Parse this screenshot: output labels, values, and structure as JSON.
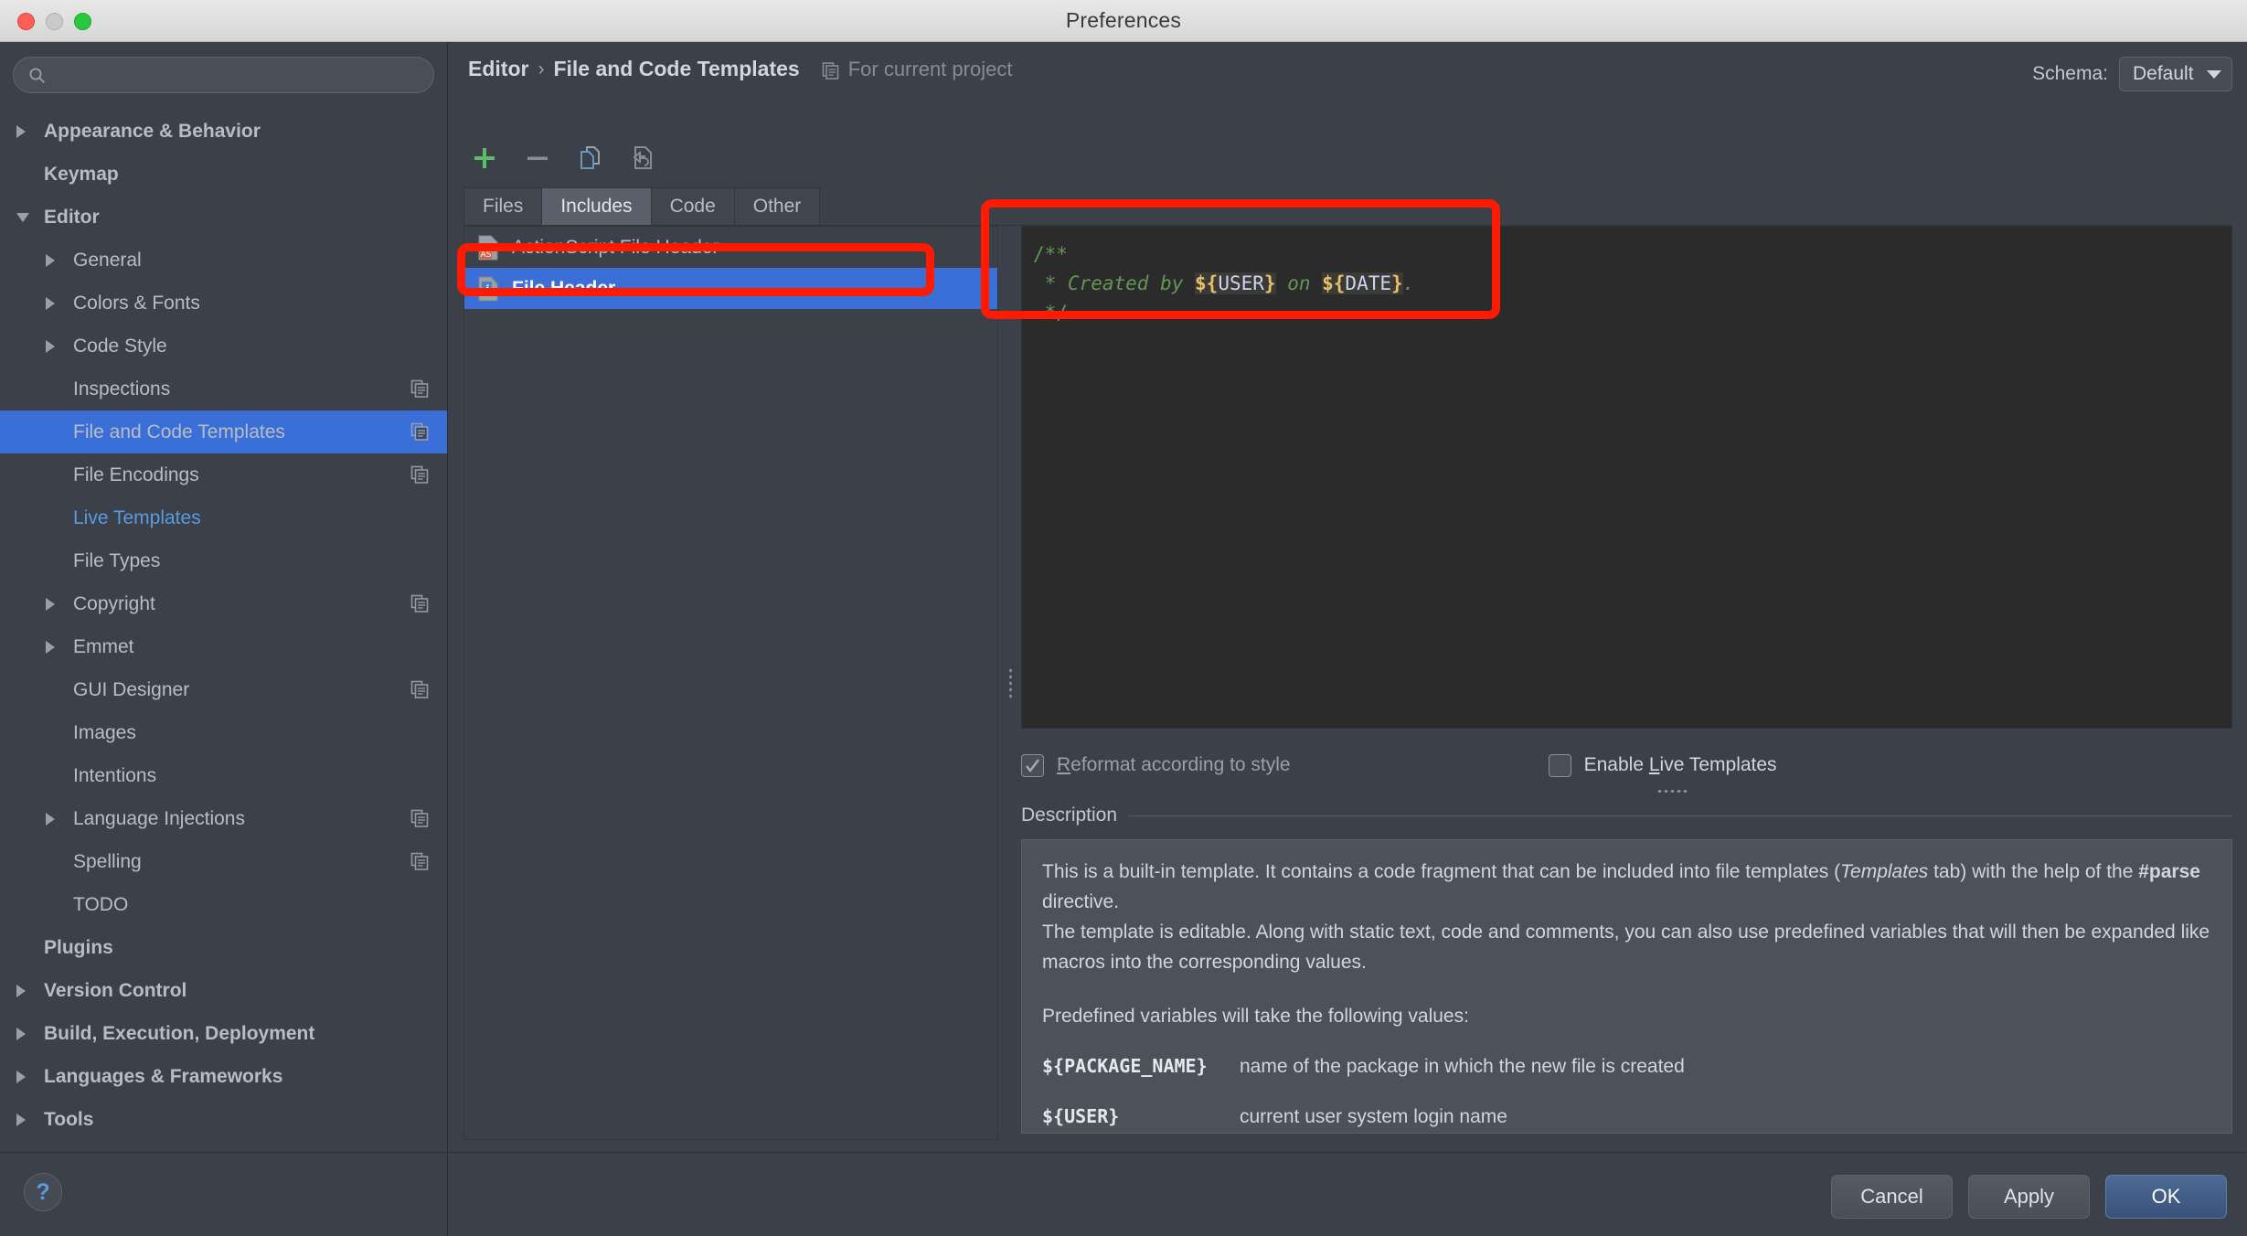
{
  "window": {
    "title": "Preferences",
    "traffic_lights": [
      "close",
      "minimize",
      "zoom"
    ]
  },
  "sidebar": {
    "search": {
      "value": "",
      "placeholder": ""
    },
    "items": [
      {
        "label": "Appearance & Behavior",
        "level": 0,
        "arrow": "right",
        "state": "normal",
        "scope_icon": false
      },
      {
        "label": "Keymap",
        "level": 0,
        "arrow": "none",
        "state": "normal",
        "scope_icon": false
      },
      {
        "label": "Editor",
        "level": 0,
        "arrow": "down",
        "state": "normal",
        "scope_icon": false
      },
      {
        "label": "General",
        "level": 1,
        "arrow": "right",
        "state": "normal",
        "scope_icon": false
      },
      {
        "label": "Colors & Fonts",
        "level": 1,
        "arrow": "right",
        "state": "normal",
        "scope_icon": false
      },
      {
        "label": "Code Style",
        "level": 1,
        "arrow": "right",
        "state": "normal",
        "scope_icon": false
      },
      {
        "label": "Inspections",
        "level": 1,
        "arrow": "none",
        "state": "normal",
        "scope_icon": true
      },
      {
        "label": "File and Code Templates",
        "level": 1,
        "arrow": "none",
        "state": "selected",
        "scope_icon": true
      },
      {
        "label": "File Encodings",
        "level": 1,
        "arrow": "none",
        "state": "normal",
        "scope_icon": true
      },
      {
        "label": "Live Templates",
        "level": 1,
        "arrow": "none",
        "state": "link",
        "scope_icon": false
      },
      {
        "label": "File Types",
        "level": 1,
        "arrow": "none",
        "state": "normal",
        "scope_icon": false
      },
      {
        "label": "Copyright",
        "level": 1,
        "arrow": "right",
        "state": "normal",
        "scope_icon": true
      },
      {
        "label": "Emmet",
        "level": 1,
        "arrow": "right",
        "state": "normal",
        "scope_icon": false
      },
      {
        "label": "GUI Designer",
        "level": 1,
        "arrow": "none",
        "state": "normal",
        "scope_icon": true
      },
      {
        "label": "Images",
        "level": 1,
        "arrow": "none",
        "state": "normal",
        "scope_icon": false
      },
      {
        "label": "Intentions",
        "level": 1,
        "arrow": "none",
        "state": "normal",
        "scope_icon": false
      },
      {
        "label": "Language Injections",
        "level": 1,
        "arrow": "right",
        "state": "normal",
        "scope_icon": true
      },
      {
        "label": "Spelling",
        "level": 1,
        "arrow": "none",
        "state": "normal",
        "scope_icon": true
      },
      {
        "label": "TODO",
        "level": 1,
        "arrow": "none",
        "state": "normal",
        "scope_icon": false
      },
      {
        "label": "Plugins",
        "level": 0,
        "arrow": "none",
        "state": "normal",
        "scope_icon": false
      },
      {
        "label": "Version Control",
        "level": 0,
        "arrow": "right",
        "state": "normal",
        "scope_icon": false
      },
      {
        "label": "Build, Execution, Deployment",
        "level": 0,
        "arrow": "right",
        "state": "normal",
        "scope_icon": false
      },
      {
        "label": "Languages & Frameworks",
        "level": 0,
        "arrow": "right",
        "state": "normal",
        "scope_icon": false
      },
      {
        "label": "Tools",
        "level": 0,
        "arrow": "right",
        "state": "normal",
        "scope_icon": false
      }
    ],
    "help_button": "?"
  },
  "header": {
    "breadcrumb_root": "Editor",
    "breadcrumb_sep": "›",
    "breadcrumb_leaf": "File and Code Templates",
    "scope_text": "For current project",
    "schema_label": "Schema:",
    "schema_value": "Default"
  },
  "toolbar": {
    "add": "add-icon",
    "remove": "remove-icon",
    "copy": "copy-template-icon",
    "reset": "reset-to-default-icon"
  },
  "tabs": [
    {
      "label": "Files",
      "active": false
    },
    {
      "label": "Includes",
      "active": true
    },
    {
      "label": "Code",
      "active": false
    },
    {
      "label": "Other",
      "active": false
    }
  ],
  "file_list": [
    {
      "label": "ActionScript File Header",
      "icon": "as-file-icon",
      "selected": false
    },
    {
      "label": "File Header",
      "icon": "js-file-icon",
      "selected": true
    }
  ],
  "editor": {
    "line1": "/**",
    "line2_a": " * Created by ",
    "line2_dollar1": "${",
    "line2_var1": "USER",
    "line2_close1": "}",
    "line2_b": " on ",
    "line2_dollar2": "${",
    "line2_var2": "DATE",
    "line2_close2": "}",
    "line2_c": ".",
    "line3": " */"
  },
  "checkboxes": [
    {
      "label_prefix": "",
      "label_underlined": "R",
      "label_rest": "eformat according to style",
      "checked": true,
      "enabled": false
    },
    {
      "label_prefix": "Enable ",
      "label_underlined": "L",
      "label_rest": "ive Templates",
      "checked": false,
      "enabled": true
    }
  ],
  "description": {
    "title": "Description",
    "para1_a": "This is a built-in template. It contains a code fragment that can be included into file templates (",
    "para1_i": "Templates",
    "para1_b": " tab) with the help of the ",
    "para1_bold": "#parse",
    "para1_c": " directive.",
    "para2": "The template is editable. Along with static text, code and comments, you can also use predefined variables that will then be expanded like macros into the corresponding values.",
    "para3": "Predefined variables will take the following values:",
    "variables": [
      {
        "name": "${PACKAGE_NAME}",
        "desc": "name of the package in which the new file is created"
      },
      {
        "name": "${USER}",
        "desc": "current user system login name"
      }
    ]
  },
  "footer": {
    "cancel": "Cancel",
    "apply": "Apply",
    "ok": "OK"
  },
  "annotations": [
    {
      "name": "file-header-highlight",
      "color": "#ff1a00"
    },
    {
      "name": "code-template-highlight",
      "color": "#ff1a00"
    }
  ]
}
